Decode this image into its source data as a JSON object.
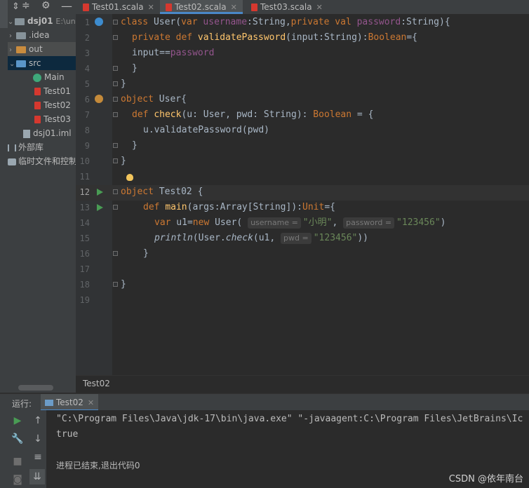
{
  "project": {
    "root_name": "dsj01",
    "root_path": "E:\\untit",
    "items": [
      {
        "label": ".idea",
        "icon": "folder-icon"
      },
      {
        "label": "out",
        "icon": "folder-orange-icon"
      },
      {
        "label": "src",
        "icon": "folder-blue-icon"
      },
      {
        "label": "Main",
        "icon": "scala-object-icon"
      },
      {
        "label": "Test01",
        "icon": "scala-file-icon"
      },
      {
        "label": "Test02",
        "icon": "scala-file-icon"
      },
      {
        "label": "Test03",
        "icon": "scala-file-icon"
      },
      {
        "label": "dsj01.iml",
        "icon": "iml-file-icon"
      },
      {
        "label": "外部库",
        "icon": "library-icon"
      },
      {
        "label": "临时文件和控制",
        "icon": "scratch-icon"
      }
    ]
  },
  "tabs": [
    {
      "label": "Test01.scala",
      "active": false
    },
    {
      "label": "Test02.scala",
      "active": true
    },
    {
      "label": "Test03.scala",
      "active": false
    }
  ],
  "editor": {
    "line_numbers": [
      "1",
      "2",
      "3",
      "4",
      "5",
      "6",
      "7",
      "8",
      "9",
      "10",
      "11",
      "12",
      "13",
      "14",
      "15",
      "16",
      "17",
      "18",
      "19"
    ],
    "current_line": "12",
    "hints": {
      "username": "username =",
      "password": "password =",
      "pwd": "pwd ="
    },
    "strings": {
      "xiaoming": "\"小明\"",
      "pw1": "\"123456\"",
      "pw2": "\"123456\""
    }
  },
  "breadcrumb": "Test02",
  "run": {
    "label": "运行:",
    "tab": "Test02",
    "output": [
      "\"C:\\Program Files\\Java\\jdk-17\\bin\\java.exe\" \"-javaagent:C:\\Program Files\\JetBrains\\Ic",
      "true",
      "",
      "进程已结束,退出代码0"
    ]
  },
  "watermark": "CSDN @依年南台",
  "colors": {
    "keyword": "#cc7832",
    "function": "#ffc66d",
    "string": "#6a8759",
    "run_green": "#499c54",
    "accent": "#4a88c7"
  }
}
